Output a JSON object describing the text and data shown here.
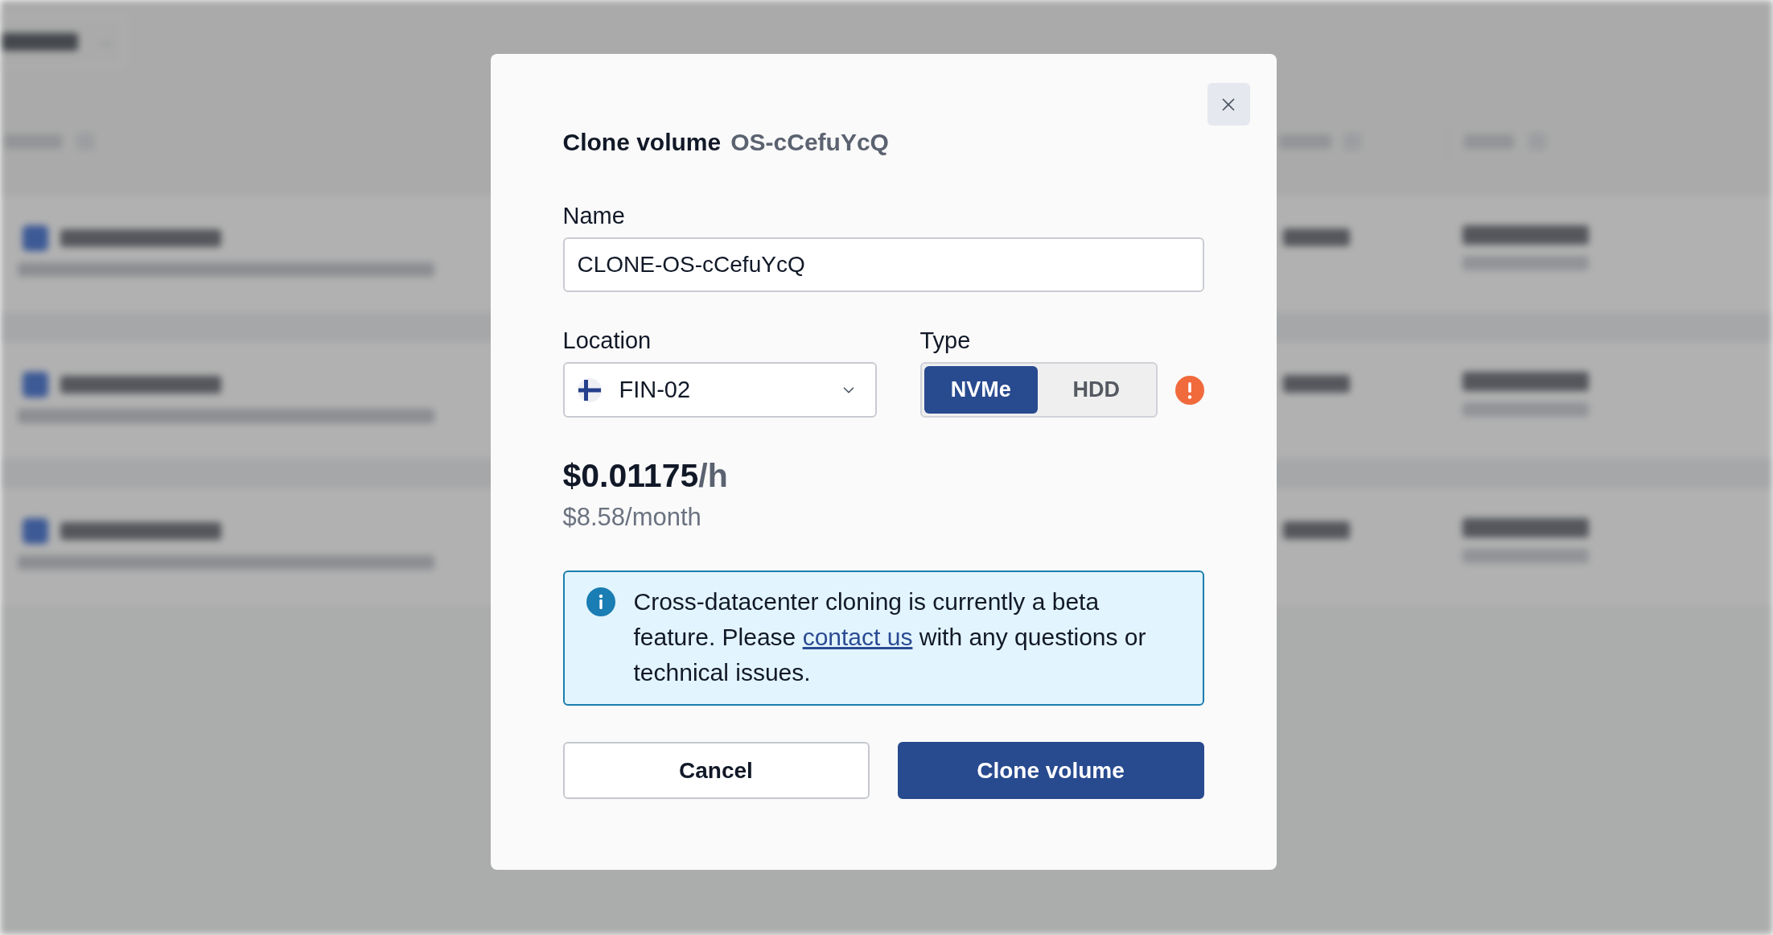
{
  "dialog": {
    "title": "Clone volume",
    "subtitle": "OS-cCefuYcQ",
    "name_field": {
      "label": "Name",
      "value": "CLONE-OS-cCefuYcQ"
    },
    "location_field": {
      "label": "Location",
      "value": "FIN-02"
    },
    "type_field": {
      "label": "Type",
      "options": [
        {
          "label": "NVMe",
          "selected": true
        },
        {
          "label": "HDD",
          "selected": false
        }
      ],
      "warning": true
    },
    "price": {
      "amount": "$0.01175",
      "unit": "/h",
      "monthly": "$8.58/month"
    },
    "notice": {
      "text_before": "Cross-datacenter cloning is currently a beta feature. Please ",
      "link": "contact us",
      "text_after": " with any questions or technical issues."
    },
    "buttons": [
      {
        "label": "Cancel",
        "kind": "secondary"
      },
      {
        "label": "Clone volume",
        "kind": "primary"
      }
    ]
  }
}
